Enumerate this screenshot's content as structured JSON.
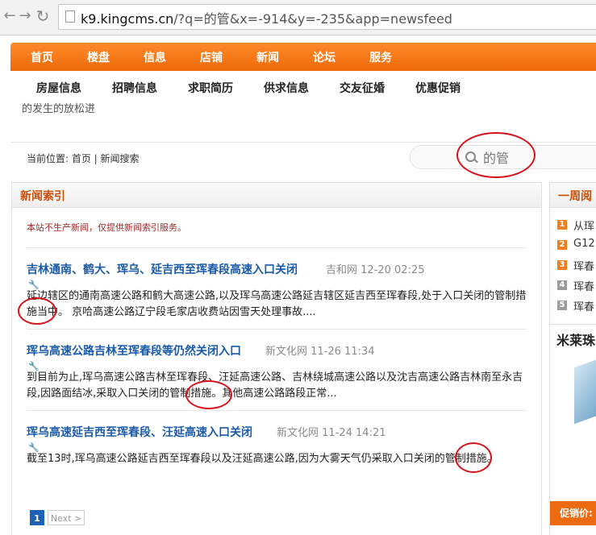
{
  "browser": {
    "url_host": "k9.kingcms.cn",
    "url_rest": "/?q=的管&x=-914&y=-235&app=newsfeed"
  },
  "topnav": [
    "首页",
    "楼盘",
    "信息",
    "店铺",
    "新闻",
    "论坛",
    "服务"
  ],
  "subnav": [
    "房屋信息",
    "招聘信息",
    "求职简历",
    "供求信息",
    "交友征婚",
    "优惠促销"
  ],
  "marquee": "的发生的放松进",
  "breadcrumb": "当前位置: 首页 | 新闻搜索",
  "search": {
    "value": "的管"
  },
  "main": {
    "title": "新闻索引",
    "notice": "本站不生产新闻，仅提供新闻索引服务。",
    "articles": [
      {
        "title": "吉林通南、鹤大、珲乌、延吉西至珲春段高速入口关闭",
        "meta": "吉和网 12-20 02:25",
        "body": "延边辖区的通南高速公路和鹤大高速公路,以及珲乌高速公路延吉辖区延吉西至珲春段,处于入口关闭的管制措施当中。 京哈高速公路辽宁段毛家店收费站因雪天处理事故...."
      },
      {
        "title": "珲乌高速公路吉林至珲春段等仍然关闭入口",
        "meta": "新文化网 11-26 11:34",
        "body": "到目前为止,珲乌高速公路吉林至珲春段、汪延高速公路、吉林绕城高速公路以及沈吉高速公路吉林南至永吉段,因路面结冰,采取入口关闭的管制措施。其他高速公路路段正常..."
      },
      {
        "title": "珲乌高速延吉西至珲春段、汪延高速入口关闭",
        "meta": "新文化网 11-24 14:21",
        "body": "截至13时,珲乌高速公路延吉西至珲春段以及汪延高速公路,因为大雾天气仍采取入口关闭的管制措施。"
      }
    ],
    "pager": {
      "current": "1",
      "next": "Next >"
    }
  },
  "sidebar": {
    "title": "一周阅",
    "ranks": [
      {
        "num": "1",
        "text": "从珲",
        "color": "#f07d1e"
      },
      {
        "num": "2",
        "text": "G12",
        "color": "#f07d1e"
      },
      {
        "num": "3",
        "text": "珲春",
        "color": "#f07d1e"
      },
      {
        "num": "4",
        "text": "珲春",
        "color": "#9c9c9c"
      },
      {
        "num": "5",
        "text": "珲春",
        "color": "#9c9c9c"
      }
    ],
    "ad_title": "米莱珠",
    "ad_bar": "促销价:"
  }
}
